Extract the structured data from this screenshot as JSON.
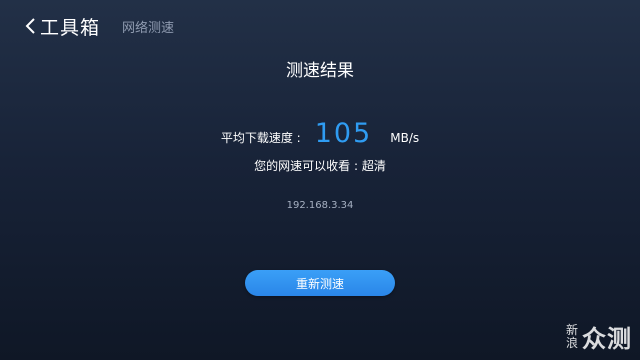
{
  "header": {
    "back_label": "工具箱",
    "breadcrumb": "网络测速"
  },
  "result": {
    "title": "测速结果",
    "avg_speed_label": "平均下载速度 :",
    "avg_speed_value": "105",
    "avg_speed_unit": "MB/s",
    "watch_quality": "您的网速可以收看 : 超清",
    "ip_address": "192.168.3.34"
  },
  "actions": {
    "retest_label": "重新测速"
  },
  "watermark": {
    "top": "新",
    "bottom": "浪",
    "main": "众测"
  },
  "colors": {
    "accent": "#2f9cf2",
    "button": "#2a86e8",
    "background": "#182338"
  },
  "icons": {
    "back": "chevron-left-icon"
  }
}
